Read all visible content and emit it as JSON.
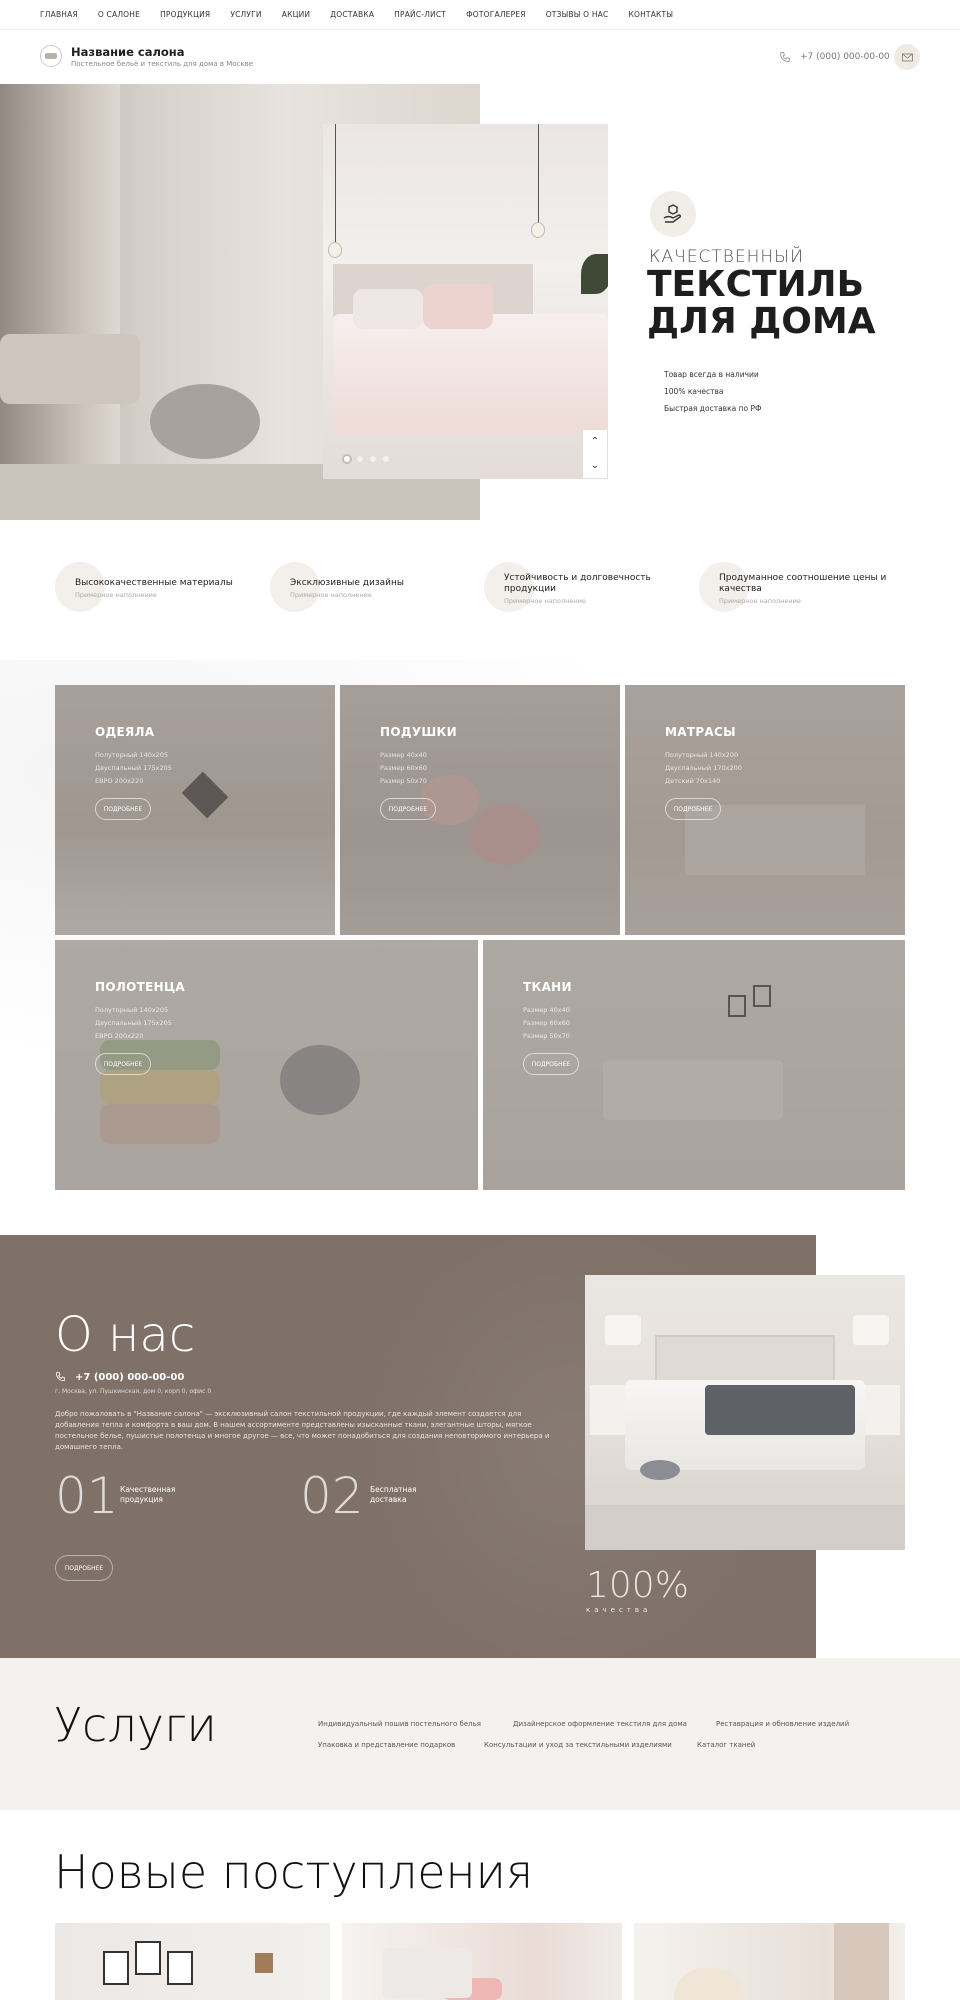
{
  "nav": [
    "ГЛАВНАЯ",
    "О САЛОНЕ",
    "ПРОДУКЦИЯ",
    "УСЛУГИ",
    "АКЦИИ",
    "ДОСТАВКА",
    "ПРАЙС-ЛИСТ",
    "ФОТОГАЛЕРЕЯ",
    "ОТЗЫВЫ О НАС",
    "КОНТАКТЫ"
  ],
  "header": {
    "title": "Название салона",
    "subtitle": "Постельное бельё и текстиль для дома в Москве",
    "phone": "+7 (000) 000-00-00"
  },
  "hero": {
    "kicker": "КАЧЕСТВЕННЫЙ",
    "title_line1": "ТЕКСТИЛЬ",
    "title_line2": "ДЛЯ ДОМА",
    "points": [
      "Товар всегда в наличии",
      "100% качества",
      "Быстрая доставка по РФ"
    ],
    "slides": 4,
    "active_slide": 1
  },
  "features": [
    {
      "title": "Высококачественные материалы",
      "sub": "Примерное наполнение"
    },
    {
      "title": "Эксклюзивные дизайны",
      "sub": "Примерное наполнение"
    },
    {
      "title": "Устойчивость и долговечность продукции",
      "sub": "Примерное наполнение"
    },
    {
      "title": "Продуманное соотношение цены и качества",
      "sub": "Примерное наполнение"
    }
  ],
  "catalog": {
    "button": "ПОДРОБНЕЕ",
    "items": [
      {
        "title": "ОДЕЯЛА",
        "lines": [
          "Полуторный 140х205",
          "Двуспальный 175х205",
          "ЕВРО 200х220"
        ]
      },
      {
        "title": "ПОДУШКИ",
        "lines": [
          "Размер 40х40",
          "Размер 60х60",
          "Размер 50х70"
        ]
      },
      {
        "title": "МАТРАСЫ",
        "lines": [
          "Полуторный 140х200",
          "Двуспальный 170х200",
          "Детский 70х140"
        ]
      },
      {
        "title": "ПОЛОТЕНЦА",
        "lines": [
          "Полуторный 140х205",
          "Двуспальный 175х205",
          "ЕВРО 200х220"
        ]
      },
      {
        "title": "ТКАНИ",
        "lines": [
          "Размер 40х40",
          "Размер 60х60",
          "Размер 50х70"
        ]
      }
    ]
  },
  "about": {
    "title": "О нас",
    "phone": "+7 (000) 000-00-00",
    "address": "г. Москва, ул. Пушкинская, дом 0, корп 0, офис 0",
    "text": "Добро пожаловать в \"Название салона\" — эксклюзивный салон текстильной продукции, где каждый элемент создается для добавления тепла и комфорта в ваш дом. В нашем ассортименте представлены изысканные ткани, элегантные шторы, мягкое постельное белье, пушистые полотенца и многое другое — все, что может понадобиться для создания неповторимого интерьера и домашнего тепла.",
    "stats": [
      {
        "num": "01",
        "label": "Качественная продукция"
      },
      {
        "num": "02",
        "label": "Бесплатная доставка"
      }
    ],
    "button": "ПОДРОБНЕЕ",
    "percent": "100%",
    "percent_label": "качества"
  },
  "services": {
    "title": "Услуги",
    "items": [
      "Индивидуальный пошив постельного белья",
      "Дизайнерское оформление текстиля для дома",
      "Реставрация и обновление изделий",
      "Упаковка и представление подарков",
      "Консультации и уход за текстильными изделиями",
      "Каталог тканей"
    ]
  },
  "new_arrivals": {
    "title": "Новые поступления"
  }
}
